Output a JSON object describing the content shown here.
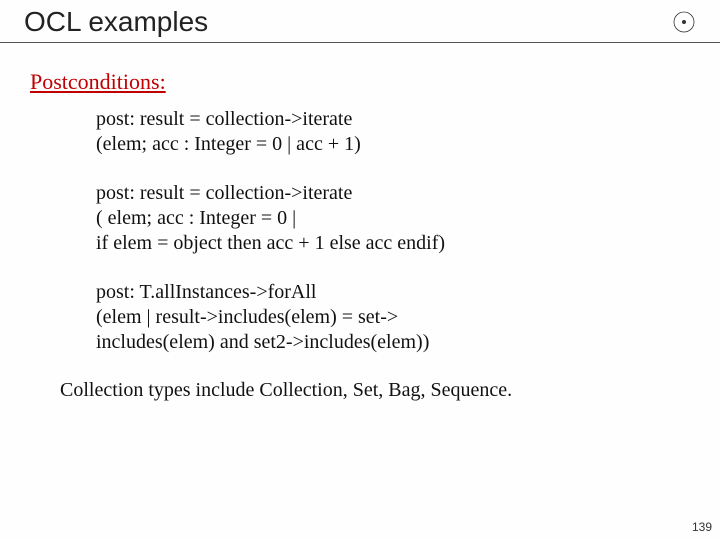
{
  "title": "OCL examples",
  "section_heading": "Postconditions:",
  "blocks": [
    {
      "l1": "post: result = collection->iterate",
      "l2": "(elem; acc : Integer = 0 | acc + 1)"
    },
    {
      "l1": "post: result = collection->iterate",
      "l2": "( elem; acc : Integer = 0 |",
      "l3": "if elem = object then acc + 1 else acc endif)"
    },
    {
      "l1": "post: T.allInstances->forAll",
      "l2": "(elem | result->includes(elem) = set->",
      "l3": "includes(elem) and set2->includes(elem))"
    }
  ],
  "footer": "Collection types include Collection, Set, Bag, Sequence.",
  "page_number": "139"
}
